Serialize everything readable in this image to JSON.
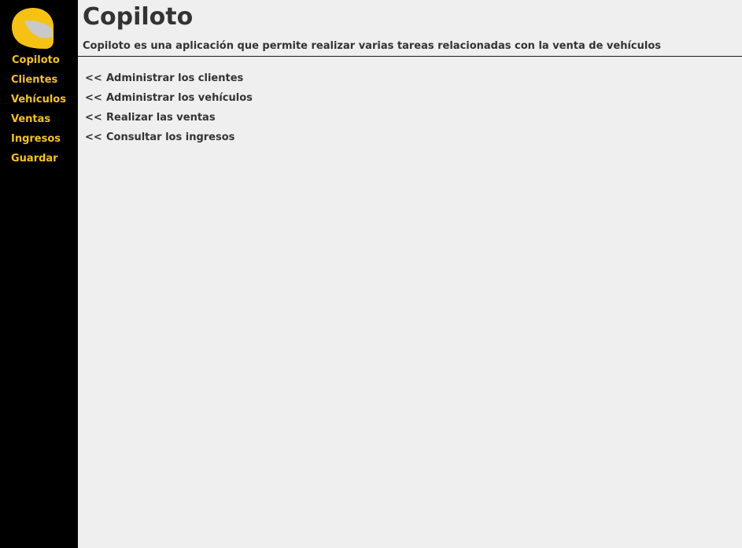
{
  "app": {
    "logo_icon": "helmet-icon",
    "accent_color": "#f5c02a",
    "sidebar_color": "#000000",
    "background_color": "#efefef"
  },
  "sidebar": {
    "items": [
      {
        "label": "Copiloto"
      },
      {
        "label": "Clientes"
      },
      {
        "label": "Vehículos"
      },
      {
        "label": "Ventas"
      },
      {
        "label": "Ingresos"
      },
      {
        "label": "Guardar"
      }
    ]
  },
  "header": {
    "title": "Copiloto",
    "subtitle": "Copiloto es una aplicación que permite realizar varias tareas relacionadas con la venta de vehículos"
  },
  "links": {
    "arrow": "<<",
    "items": [
      {
        "label": "Administrar los clientes"
      },
      {
        "label": "Administrar los vehículos"
      },
      {
        "label": "Realizar las ventas"
      },
      {
        "label": "Consultar los ingresos"
      }
    ]
  }
}
